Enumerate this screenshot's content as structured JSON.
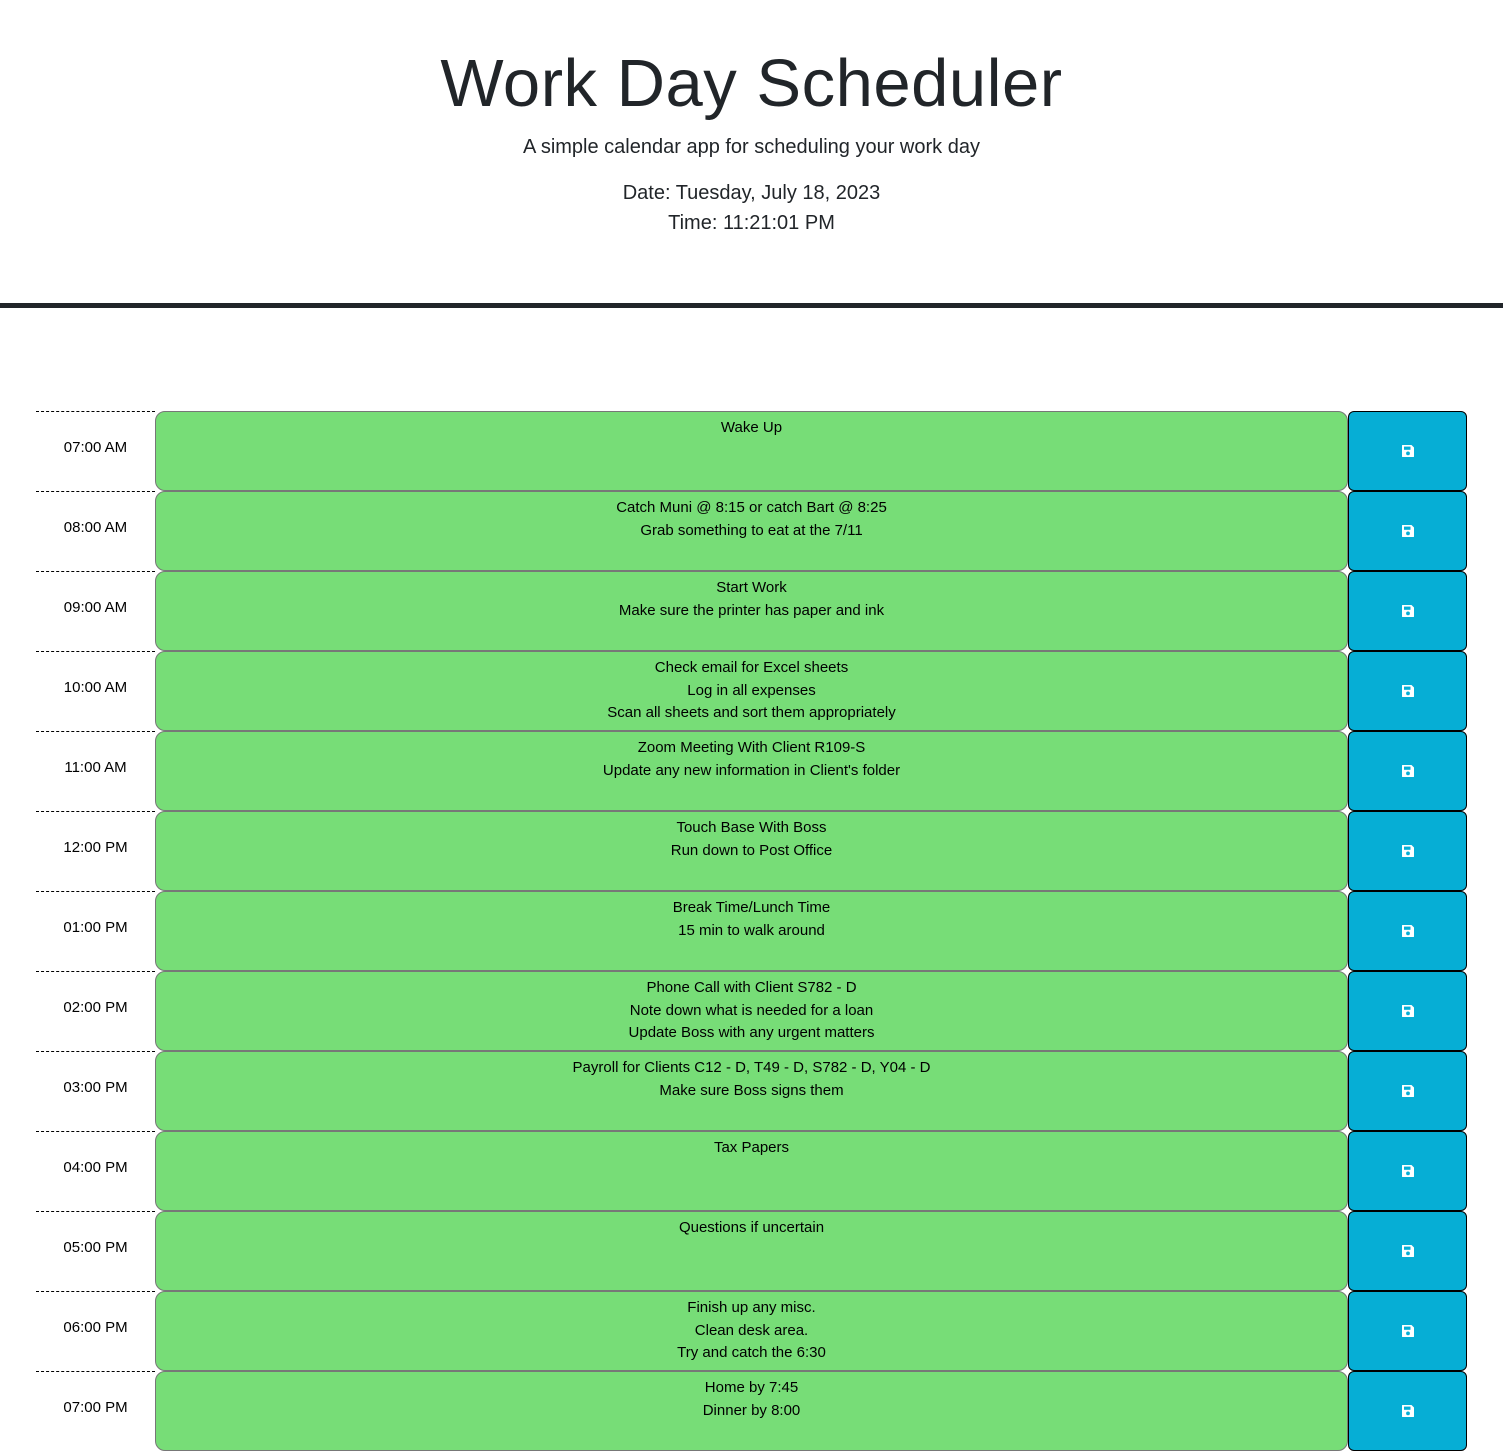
{
  "header": {
    "title": "Work Day Scheduler",
    "subtitle": "A simple calendar app for scheduling your work day",
    "date": "Date: Tuesday, July 18, 2023",
    "time": "Time: 11:21:01 PM"
  },
  "colors": {
    "present_past_future": "#77dd77",
    "save_button": "#06aed5"
  },
  "save_icon": "floppy-disk-icon",
  "rows": [
    {
      "hour": "07:00 AM",
      "text": "Wake Up"
    },
    {
      "hour": "08:00 AM",
      "text": "Catch Muni @ 8:15 or catch Bart @ 8:25\nGrab something to eat at the 7/11"
    },
    {
      "hour": "09:00 AM",
      "text": "Start Work\nMake sure the printer has paper and ink"
    },
    {
      "hour": "10:00 AM",
      "text": "Check email for Excel sheets\nLog in all expenses\nScan all sheets and sort them appropriately"
    },
    {
      "hour": "11:00 AM",
      "text": "Zoom Meeting With Client R109-S\nUpdate any new information in Client's folder"
    },
    {
      "hour": "12:00 PM",
      "text": "Touch Base With Boss\nRun down to Post Office"
    },
    {
      "hour": "01:00 PM",
      "text": "Break Time/Lunch Time\n15 min to walk around"
    },
    {
      "hour": "02:00 PM",
      "text": "Phone Call with Client S782 - D\nNote down what is needed for a loan\nUpdate Boss with any urgent matters"
    },
    {
      "hour": "03:00 PM",
      "text": "Payroll for Clients C12 - D, T49 - D, S782 - D, Y04 - D\nMake sure Boss signs them"
    },
    {
      "hour": "04:00 PM",
      "text": "Tax Papers"
    },
    {
      "hour": "05:00 PM",
      "text": "Questions if uncertain"
    },
    {
      "hour": "06:00 PM",
      "text": "Finish up any misc.\nClean desk area.\nTry and catch the 6:30"
    },
    {
      "hour": "07:00 PM",
      "text": "Home by 7:45\nDinner by 8:00"
    }
  ]
}
